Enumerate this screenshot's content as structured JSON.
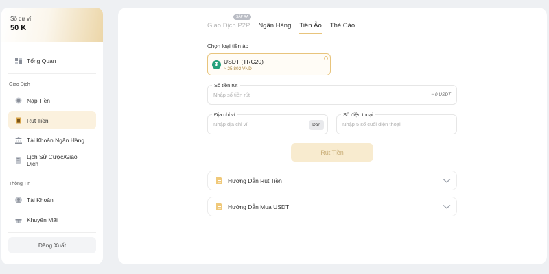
{
  "sidebar": {
    "balance": {
      "label": "Số dư ví",
      "value": "50 K"
    },
    "overview": "Tổng Quan",
    "section_transactions": "Giao Dịch",
    "items_transactions": [
      {
        "label": "Nạp Tiền",
        "icon": "deposit-icon"
      },
      {
        "label": "Rút Tiền",
        "icon": "withdraw-icon",
        "active": true
      },
      {
        "label": "Tài Khoản Ngân Hàng",
        "icon": "bank-icon"
      },
      {
        "label": "Lịch Sử Cược/Giao Dịch",
        "icon": "history-icon"
      }
    ],
    "section_info": "Thông Tin",
    "items_info": [
      {
        "label": "Tài Khoản",
        "icon": "user-icon"
      },
      {
        "label": "Khuyến Mãi",
        "icon": "gift-icon"
      }
    ],
    "logout": "Đăng Xuất"
  },
  "tabs": [
    {
      "label": "Giao Dịch P2P",
      "badge": "SẮP RA",
      "disabled": true
    },
    {
      "label": "Ngân Hàng"
    },
    {
      "label": "Tiền Ảo",
      "active": true
    },
    {
      "label": "Thẻ Cào"
    }
  ],
  "form": {
    "coin_label": "Chọn loại tiền ảo",
    "coin": {
      "name": "USDT (TRC20)",
      "rate": "≈ 25,802 VND",
      "icon": "tether-icon",
      "color": "#26a17b"
    },
    "amount": {
      "label": "Số tiền rút",
      "placeholder": "Nhập số tiền rút",
      "suffix": "≈ 0 USDT"
    },
    "wallet": {
      "label": "Địa chỉ ví",
      "placeholder": "Nhập địa chỉ ví",
      "paste": "Dán"
    },
    "phone": {
      "label": "Số điện thoại",
      "placeholder": "Nhập 5 số cuối điện thoại"
    },
    "submit": "Rút Tiền"
  },
  "guides": [
    {
      "title": "Hướng Dẫn Rút Tiền"
    },
    {
      "title": "Hướng Dẫn Mua USDT"
    }
  ],
  "colors": {
    "accent": "#e8c47c",
    "accent_light": "#fbf1de",
    "usdt": "#26a17b"
  }
}
